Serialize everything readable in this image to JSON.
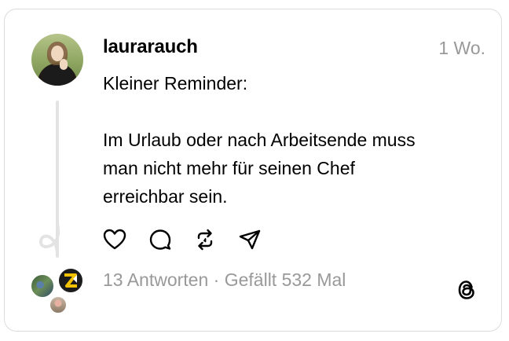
{
  "post": {
    "username": "laurarauch",
    "timestamp": "1 Wo.",
    "lines": [
      "Kleiner Reminder:",
      "Im Urlaub oder nach Arbeitsende muss",
      "man nicht mehr für seinen Chef",
      "erreichbar sein."
    ]
  },
  "footer": {
    "replies": "13 Antworten",
    "separator": " · ",
    "likes": "Gefällt 532 Mal"
  },
  "icons": {
    "like": "heart-icon",
    "reply": "comment-icon",
    "repost": "repost-icon",
    "share": "send-icon",
    "brand": "threads-logo-icon"
  },
  "colors": {
    "text": "#000000",
    "muted": "#999999",
    "border": "#dcdcdc",
    "thread_line": "#e3e3e3"
  }
}
